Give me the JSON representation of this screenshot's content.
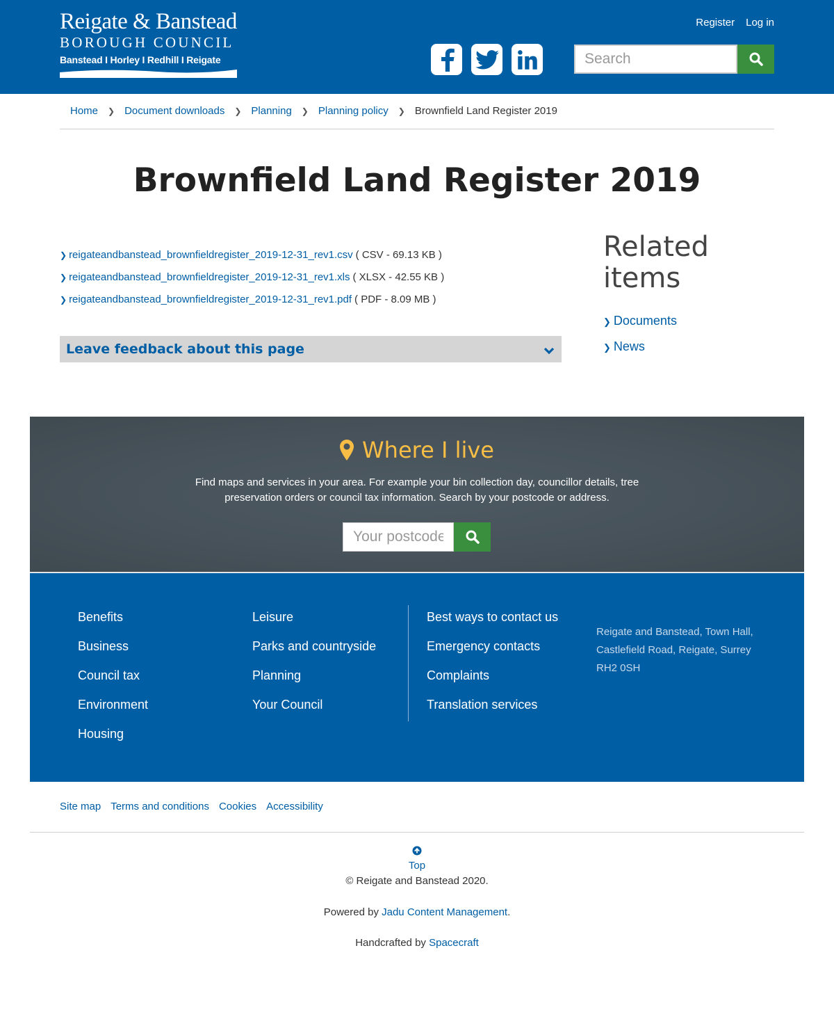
{
  "header": {
    "logo": {
      "line1": "Reigate & Banstead",
      "line2": "BOROUGH COUNCIL",
      "line3": "Banstead I Horley I Redhill I Reigate"
    },
    "register": "Register",
    "login": "Log in",
    "social": [
      "facebook-icon",
      "twitter-icon",
      "linkedin-icon"
    ],
    "search_placeholder": "Search"
  },
  "breadcrumb": {
    "items": [
      "Home",
      "Document downloads",
      "Planning",
      "Planning policy"
    ],
    "current": "Brownfield Land Register 2019"
  },
  "page": {
    "title": "Brownfield Land Register 2019",
    "files": [
      {
        "name": "reigateandbanstead_brownfieldregister_2019-12-31_rev1.csv",
        "meta": "( CSV - 69.13 KB )"
      },
      {
        "name": "reigateandbanstead_brownfieldregister_2019-12-31_rev1.xls",
        "meta": "( XLSX - 42.55 KB )"
      },
      {
        "name": "reigateandbanstead_brownfieldregister_2019-12-31_rev1.pdf",
        "meta": "( PDF - 8.09 MB )"
      }
    ],
    "feedback": "Leave feedback about this page"
  },
  "related": {
    "heading": "Related items",
    "items": [
      "Documents",
      "News"
    ]
  },
  "where_i_live": {
    "title": "Where I live",
    "description": "Find maps and services in your area. For example your bin collection day, councillor details, tree preservation orders or council tax information. Search by your postcode or address.",
    "postcode_placeholder": "Your postcode"
  },
  "footer": {
    "col1": [
      "Benefits",
      "Business",
      "Council tax",
      "Environment",
      "Housing"
    ],
    "col2": [
      "Leisure",
      "Parks and countryside",
      "Planning",
      "Your Council"
    ],
    "col3": [
      "Best ways to contact us",
      "Emergency contacts",
      "Complaints",
      "Translation services"
    ],
    "address": [
      "Reigate and Banstead, Town Hall,",
      "Castlefield Road, Reigate, Surrey",
      "RH2 0SH"
    ],
    "bottom_links": [
      "Site map",
      "Terms and conditions",
      "Cookies",
      "Accessibility"
    ],
    "top": "Top",
    "copyright": "© Reigate and Banstead 2020.",
    "powered_prefix": "Powered by ",
    "powered_link": "Jadu Content Management",
    "powered_suffix": ".",
    "crafted_prefix": "Handcrafted by ",
    "crafted_link": "Spacecraft"
  },
  "colors": {
    "brand_blue": "#005ea5",
    "search_green": "#3a8f3f",
    "where_i_live_gold": "#f7bd45",
    "where_i_live_bg": "#4e5a63"
  }
}
